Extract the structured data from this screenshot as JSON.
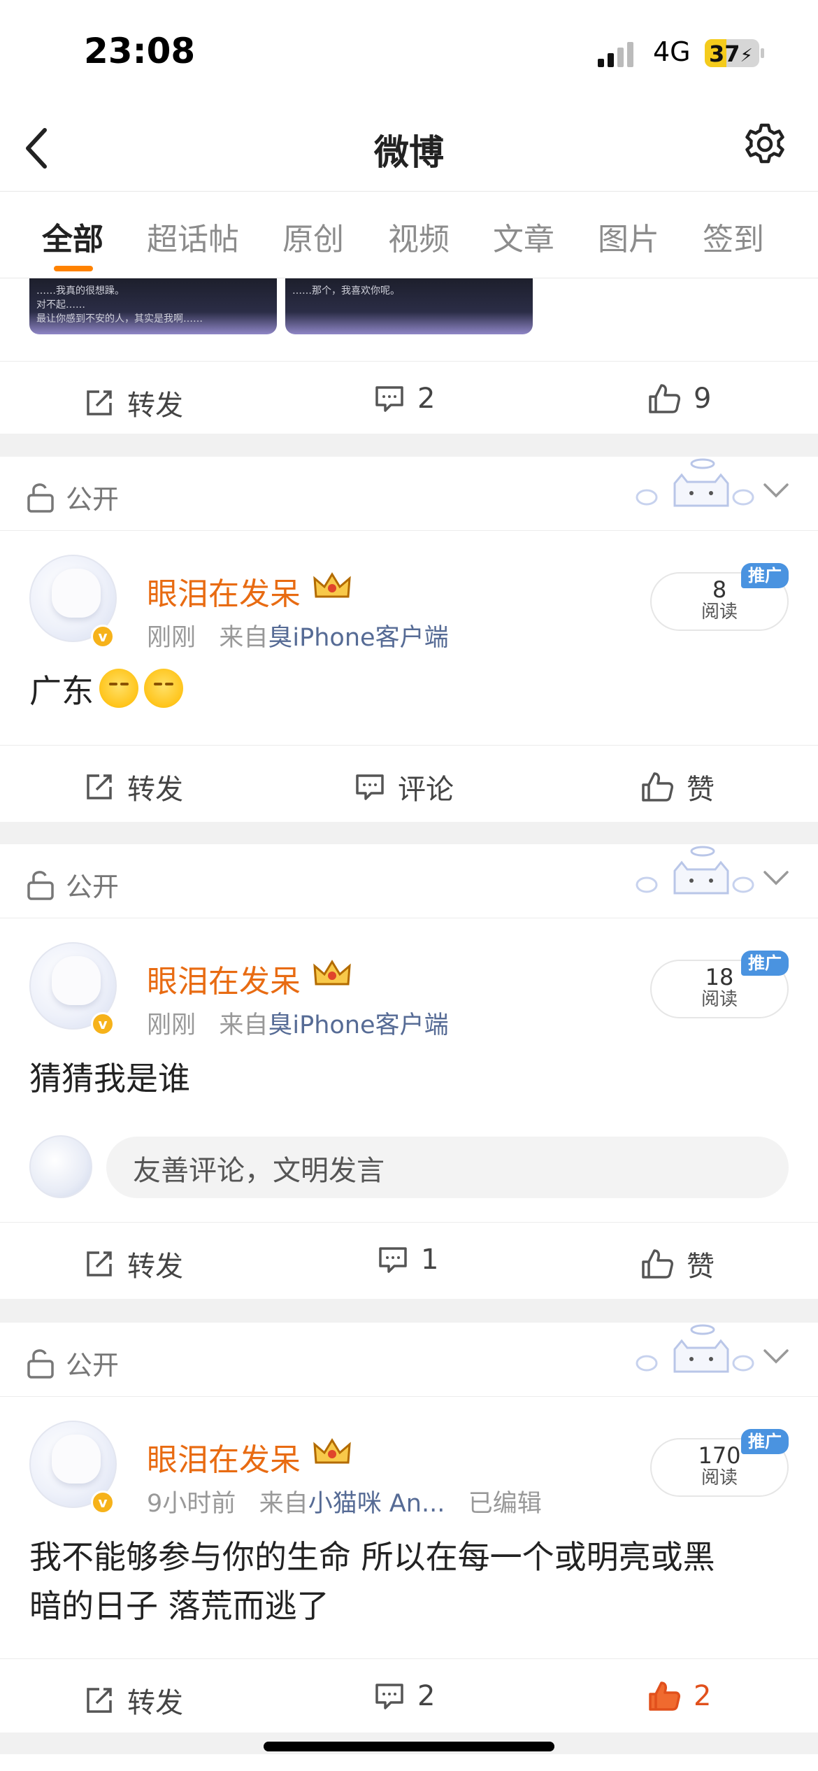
{
  "status_bar": {
    "time": "23:08",
    "network": "4G",
    "battery": "37"
  },
  "nav": {
    "title": "微博"
  },
  "tabs": [
    {
      "label": "全部",
      "active": true
    },
    {
      "label": "超话帖"
    },
    {
      "label": "原创"
    },
    {
      "label": "视频"
    },
    {
      "label": "文章"
    },
    {
      "label": "图片"
    },
    {
      "label": "签到"
    }
  ],
  "top_partial": {
    "thumb1_lines": [
      "……我真的很想躁。",
      "对不起……",
      "最让你感到不安的人，其实是我啊……"
    ],
    "thumb2_lines": [
      "……那个，我喜欢你呢。"
    ],
    "actions": {
      "repost": "转发",
      "comment": "2",
      "like": "9"
    }
  },
  "posts": [
    {
      "visibility": "公开",
      "username": "眼泪在发呆",
      "time": "刚刚",
      "from_prefix": "来自",
      "source": "臭iPhone客户端",
      "edited": "",
      "reads_num": "8",
      "reads_label": "阅读",
      "promo": "推广",
      "text": "广东",
      "actions": {
        "repost": "转发",
        "comment": "评论",
        "like": "赞",
        "liked": false
      }
    },
    {
      "visibility": "公开",
      "username": "眼泪在发呆",
      "time": "刚刚",
      "from_prefix": "来自",
      "source": "臭iPhone客户端",
      "edited": "",
      "reads_num": "18",
      "reads_label": "阅读",
      "promo": "推广",
      "text": "猜猜我是谁",
      "comment_placeholder": "友善评论，文明发言",
      "actions": {
        "repost": "转发",
        "comment": "1",
        "like": "赞",
        "liked": false
      }
    },
    {
      "visibility": "公开",
      "username": "眼泪在发呆",
      "time": "9小时前",
      "from_prefix": "来自",
      "source": "小猫咪 An...",
      "edited": "已编辑",
      "reads_num": "170",
      "reads_label": "阅读",
      "promo": "推广",
      "text_line1": "我不能够参与你的生命 所以在每一个或明亮或黑",
      "text_line2": "暗的日子 落荒而逃了",
      "actions": {
        "repost": "转发",
        "comment": "2",
        "like": "2",
        "liked": true
      }
    }
  ],
  "colors": {
    "accent": "#ff8200",
    "username": "#e86b12",
    "liked": "#e1501c",
    "source": "#566b95"
  }
}
